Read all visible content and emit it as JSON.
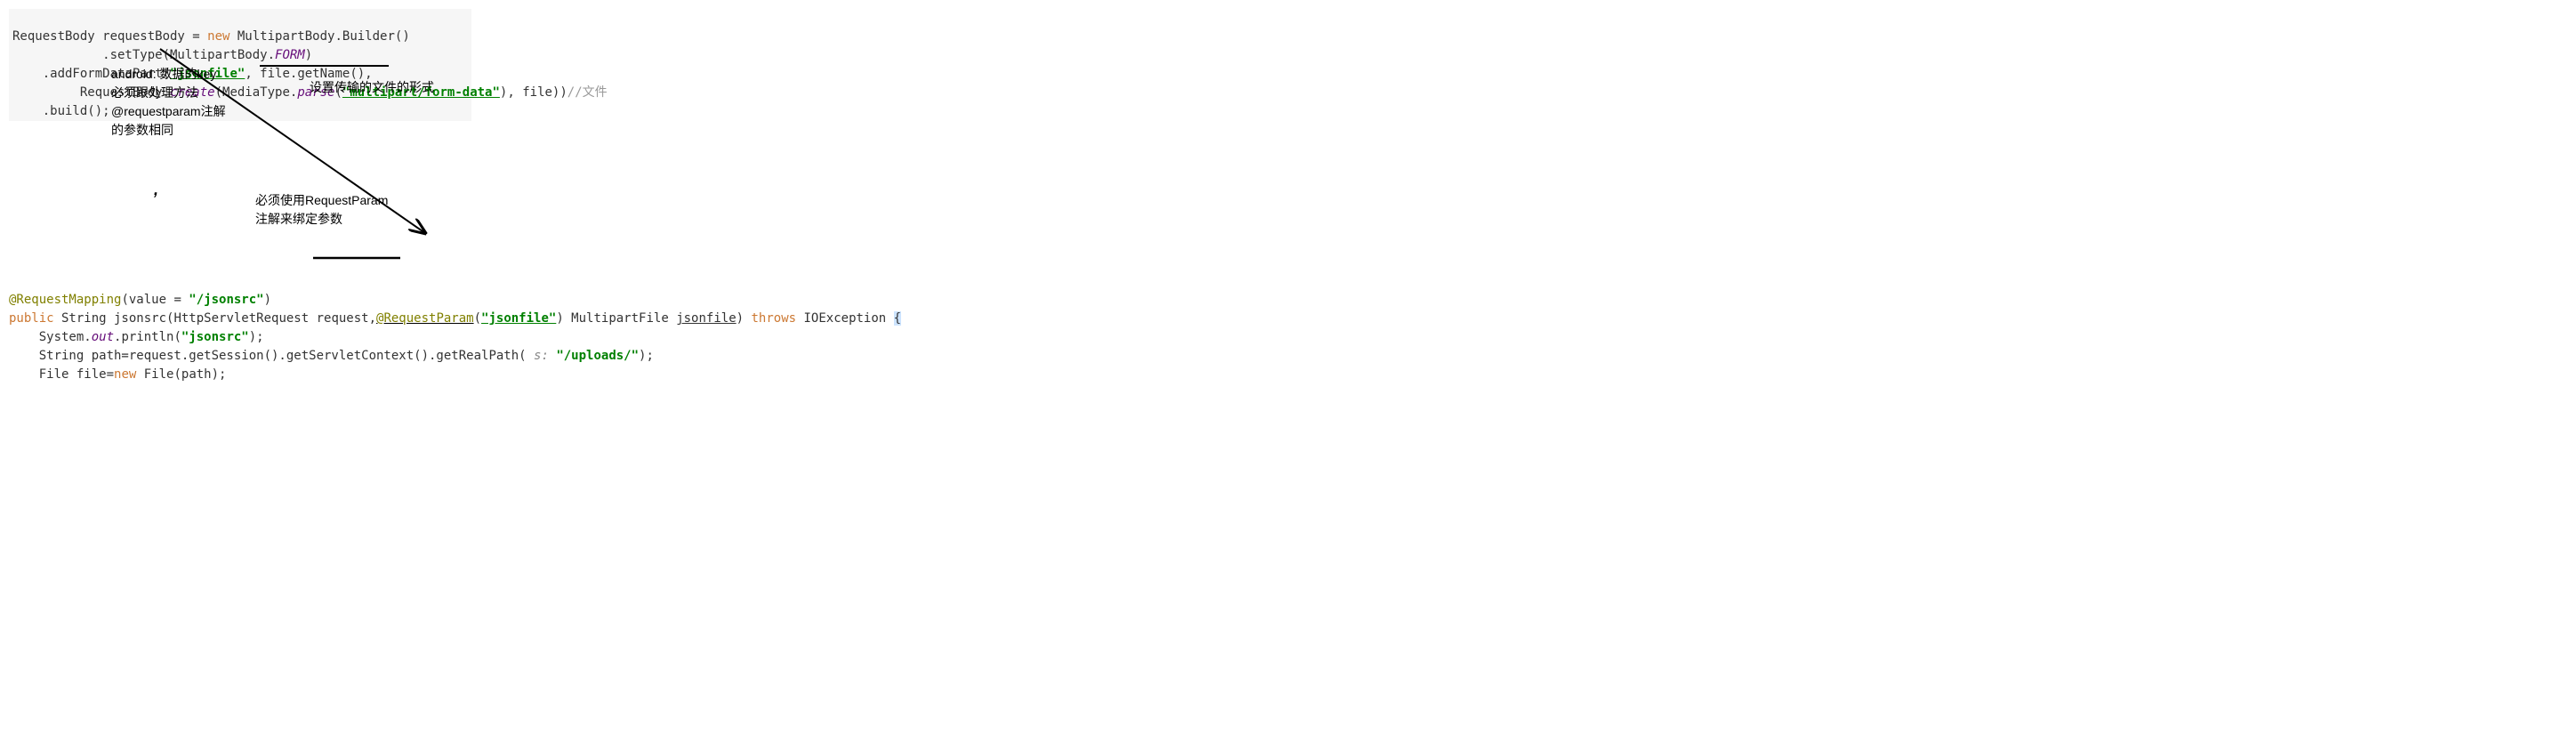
{
  "top": {
    "l1_a": "RequestBody requestBody = ",
    "l1_new": "new",
    "l1_b": " MultipartBody.Builder()",
    "l2_a": "            .setType(MultipartBody.",
    "l2_form": "FORM",
    "l2_b": ")",
    "l3_a": "    .addFormDataPart(",
    "l3_str1": "\"jsonfile\"",
    "l3_b": ", file.getName(),",
    "l4_a": "         RequestBody.",
    "l4_create": "create",
    "l4_b": "(MediaType.",
    "l4_parse": "parse",
    "l4_c": "(",
    "l4_str": "\"multipart/form-data\"",
    "l4_d": "), file))",
    "l4_comment": "//文件",
    "l5": "    .build();"
  },
  "ann1": {
    "l1": "android: 数据的key",
    "l2": "必须跟处理方法",
    "l3": "@requestparam注解",
    "l4": "的参数相同"
  },
  "ann2": "设置传输的文件的形式",
  "ann3": {
    "l1": "必须使用RequestParam",
    "l2": "注解来绑定参数"
  },
  "bot": {
    "l1_anno": "@RequestMapping",
    "l1_a": "(value = ",
    "l1_str": "\"/jsonsrc\"",
    "l1_b": ")",
    "l2_pub": "public",
    "l2_a": " String jsonsrc(HttpServletRequest request,",
    "l2_anno": "@RequestParam",
    "l2_b": "(",
    "l2_str": "\"jsonfile\"",
    "l2_c": ") MultipartFile ",
    "l2_u": "jsonfile",
    "l2_d": ") ",
    "l2_throws": "throws",
    "l2_e": " IOException ",
    "l2_brace": "{",
    "l3_a": "    System.",
    "l3_out": "out",
    "l3_b": ".println(",
    "l3_str": "\"jsonsrc\"",
    "l3_c": ");",
    "l4_a": "    String path=request.getSession().getServletContext().getRealPath(",
    "l4_param": " s: ",
    "l4_str": "\"/uploads/\"",
    "l4_b": ");",
    "l5_a": "    File file=",
    "l5_new": "new",
    "l5_b": " File(path);"
  }
}
